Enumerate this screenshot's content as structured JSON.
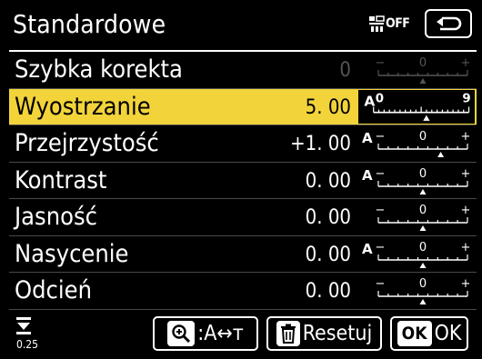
{
  "title": "Standardowe",
  "off_badge": {
    "icon": "picture-control-off-icon",
    "label": "OFF"
  },
  "back_button": {
    "icon": "back-arrow-icon"
  },
  "rows": [
    {
      "label": "Szybka korekta",
      "value": "0",
      "state": "disabled",
      "scale": {
        "type": "quick",
        "has_a": false,
        "level": 0.5,
        "ticks": [
          "−",
          "0",
          "+"
        ]
      }
    },
    {
      "label": "Wyostrzanie",
      "value": "5. 00",
      "state": "selected",
      "scale": {
        "type": "numbered",
        "has_a": true,
        "level": 0.555,
        "ticks": [
          "0",
          "9"
        ]
      }
    },
    {
      "label": "Przejrzystość",
      "value": "+1. 00",
      "state": "normal",
      "scale": {
        "type": "plusminus",
        "has_a": true,
        "level": 0.7,
        "ticks": [
          "−",
          "0",
          "+"
        ]
      }
    },
    {
      "label": "Kontrast",
      "value": "0. 00",
      "state": "normal",
      "scale": {
        "type": "plusminus",
        "has_a": true,
        "level": 0.5,
        "ticks": [
          "−",
          "0",
          "+"
        ]
      }
    },
    {
      "label": "Jasność",
      "value": "0. 00",
      "state": "normal",
      "scale": {
        "type": "plusminus",
        "has_a": false,
        "level": 0.5,
        "ticks": [
          "−",
          "0",
          "+"
        ]
      }
    },
    {
      "label": "Nasycenie",
      "value": "0. 00",
      "state": "normal",
      "scale": {
        "type": "plusminus",
        "has_a": true,
        "level": 0.5,
        "ticks": [
          "−",
          "0",
          "+"
        ]
      }
    },
    {
      "label": "Odcień",
      "value": "0. 00",
      "state": "normal",
      "scale": {
        "type": "plusminus",
        "has_a": false,
        "level": 0.5,
        "ticks": [
          "−",
          "0",
          "+"
        ]
      }
    }
  ],
  "step": {
    "icon": "step-increment-icon",
    "value": "0.25"
  },
  "buttons": {
    "zoom": {
      "icon": "zoom-in-key-icon",
      "label": ":A↔т"
    },
    "reset": {
      "icon": "trash-key-icon",
      "label": "Resetuj"
    },
    "ok": {
      "key": "OK",
      "label": "OK"
    }
  },
  "colors": {
    "highlight": "#f2d43a",
    "background": "#000000",
    "text": "#ffffff",
    "disabled": "#555555"
  }
}
